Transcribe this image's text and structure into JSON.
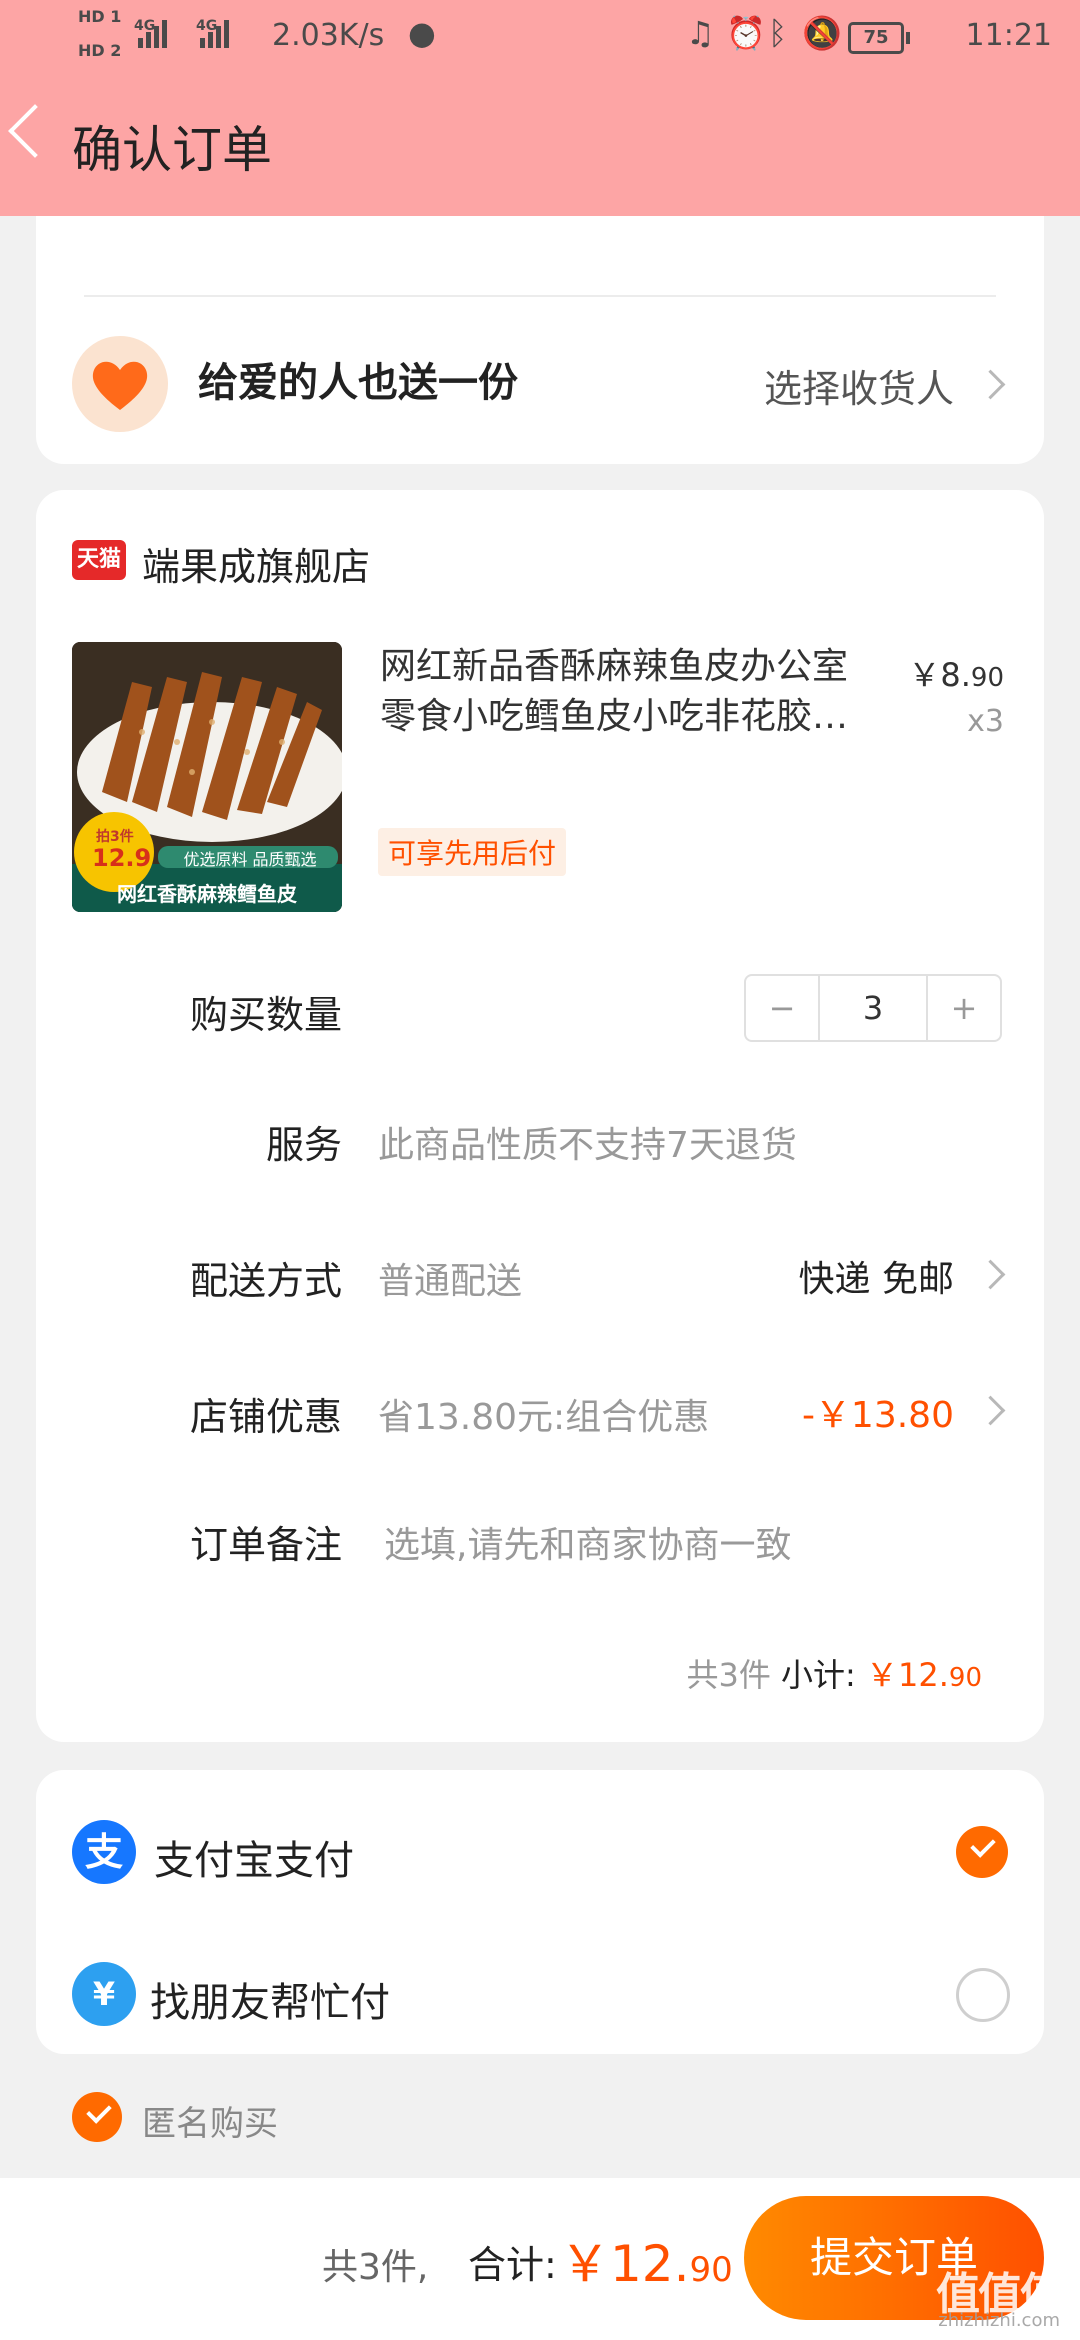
{
  "status_bar": {
    "hd1": "HD 1",
    "hd2": "HD 2",
    "net1": "4G",
    "net2": "4G",
    "speed": "2.03K/s",
    "battery": "75",
    "time": "11:21"
  },
  "header": {
    "title": "确认订单"
  },
  "gift": {
    "label": "给爱的人也送一份",
    "action": "选择收货人"
  },
  "shop": {
    "badge": "天猫",
    "name": "端果成旗舰店"
  },
  "product": {
    "name": "网红新品香酥麻辣鱼皮办公室零食小吃鳕鱼皮小吃非花胶…",
    "price_symbol": "￥",
    "price_int": "8.",
    "price_dec": "90",
    "qty": "x3",
    "tag": "可享先用后付",
    "image_caption": "网红香酥麻辣鳕鱼皮",
    "image_sub": "优选原料 品质甄选",
    "image_price": "12.9",
    "image_promo": "拍3件"
  },
  "rows": {
    "qty_label": "购买数量",
    "qty_minus": "−",
    "qty_value": "3",
    "qty_plus": "+",
    "service_label": "服务",
    "service_value": "此商品性质不支持7天退货",
    "delivery_label": "配送方式",
    "delivery_value": "普通配送",
    "delivery_right": "快递 免邮",
    "discount_label": "店铺优惠",
    "discount_value": "省13.80元:组合优惠",
    "discount_amount": "-￥13.80",
    "note_label": "订单备注",
    "note_placeholder": "选填,请先和商家协商一致"
  },
  "subtotal": {
    "count": "共3件",
    "label": "小计:",
    "symbol": "￥",
    "int": "12.",
    "dec": "90"
  },
  "payment": {
    "alipay_label": "支付宝支付",
    "alipay_icon": "支",
    "friend_label": "找朋友帮忙付",
    "friend_icon": "¥"
  },
  "anonymous": {
    "label": "匿名购买"
  },
  "bottom": {
    "count": "共3件,",
    "label": "合计:",
    "symbol": "￥",
    "int": "12.",
    "dec": "90",
    "submit": "提交订单"
  },
  "watermark": {
    "logo": "值值值",
    "site": "zhizhizhi.com"
  },
  "colors": {
    "header_bg": "#fda5a5",
    "accent": "#ff5000",
    "alipay": "#1677ff"
  }
}
